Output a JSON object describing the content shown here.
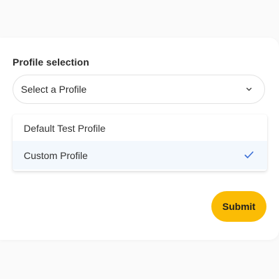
{
  "form": {
    "label": "Profile selection",
    "select": {
      "value": "Select a Profile",
      "icon": "chevron-down-icon"
    },
    "options": [
      {
        "label": "Default Test Profile",
        "selected": false
      },
      {
        "label": "Custom Profile",
        "selected": true
      }
    ],
    "submit_label": "Submit"
  },
  "colors": {
    "accent": "#fbbc05",
    "check": "#3b6fd6",
    "selected_bg": "#f3f8fd"
  }
}
